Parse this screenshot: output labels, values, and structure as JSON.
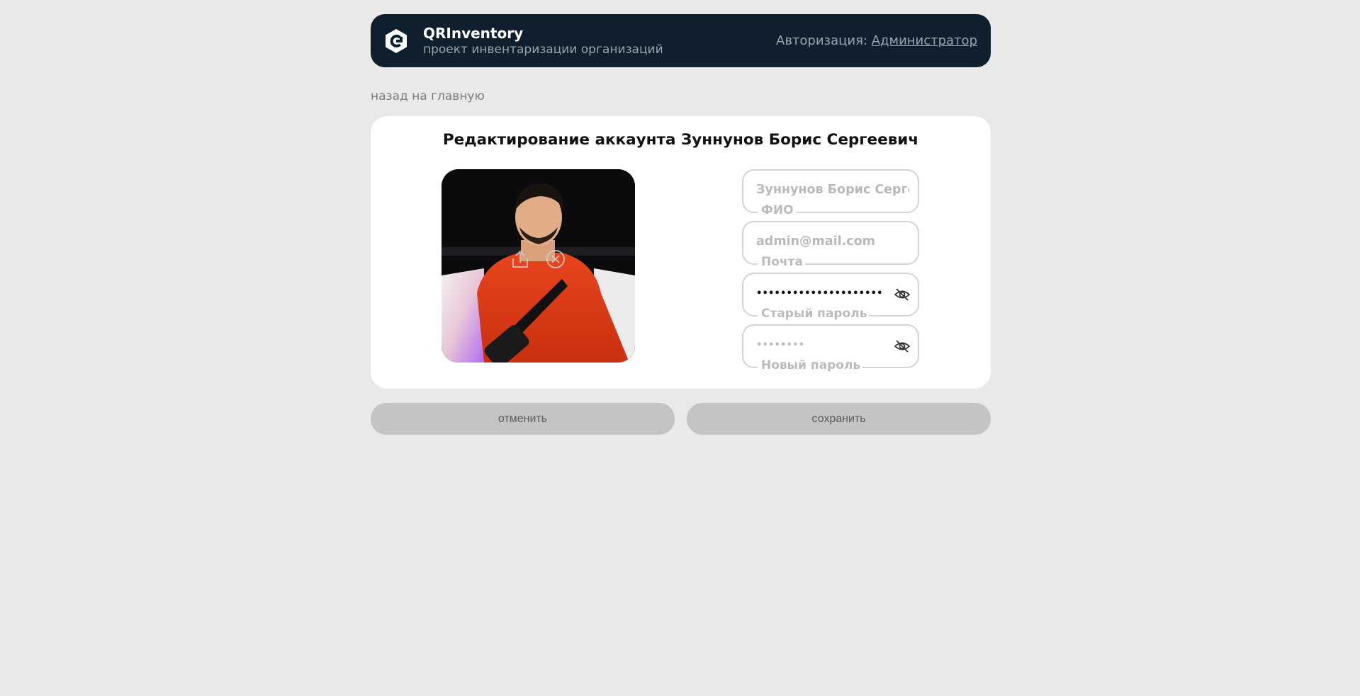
{
  "header": {
    "brand_name": "QRInventory",
    "brand_subtitle": "проект инвентаризации организаций",
    "auth_prefix": "Авторизация:",
    "auth_role": "Администратор",
    "logo_icon": "qr-inventory-logo-icon",
    "background_color": "#0f1f2d"
  },
  "nav": {
    "back_label": "назад на главную"
  },
  "form": {
    "title": "Редактирование аккаунта Зуннунов Борис Сергеевич",
    "photo": {
      "alt": "фото профиля",
      "upload_icon": "upload-icon",
      "remove_icon": "remove-icon"
    },
    "fields": {
      "name": {
        "value": "Зуннунов Борис Сергеевич",
        "label": "ФИО"
      },
      "email": {
        "value": "admin@mail.com",
        "label": "Почта"
      },
      "old_password": {
        "value": "••••••••••••••••••••••••",
        "label": "Старый пароль",
        "toggle_icon": "eye-off-icon"
      },
      "new_password": {
        "value": "••••••••",
        "label": "Новый пароль",
        "toggle_icon": "eye-off-icon"
      }
    }
  },
  "actions": {
    "cancel_label": "отменить",
    "save_label": "сохранить",
    "button_color": "#c4c4c4"
  }
}
